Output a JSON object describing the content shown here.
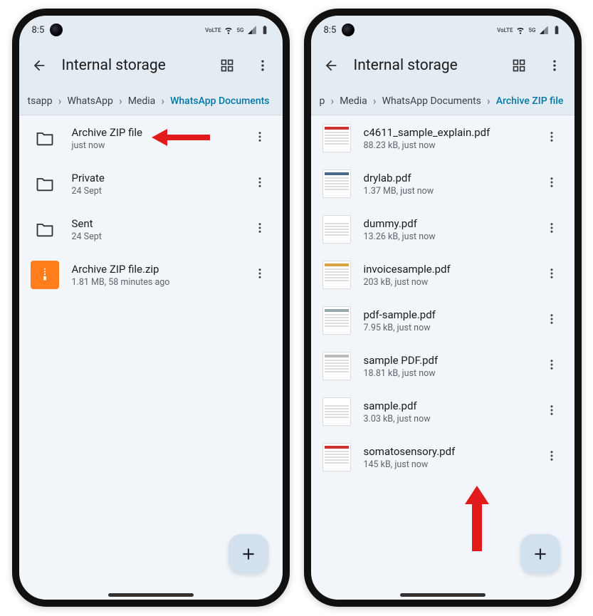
{
  "status": {
    "time": "8:5",
    "net1": "VoLTE",
    "net2": "5G"
  },
  "appbar": {
    "title": "Internal storage"
  },
  "phone1": {
    "breadcrumb": [
      {
        "label": "tsapp",
        "active": false,
        "truncated": true
      },
      {
        "label": "WhatsApp",
        "active": false
      },
      {
        "label": "Media",
        "active": false
      },
      {
        "label": "WhatsApp Documents",
        "active": true
      }
    ],
    "items": [
      {
        "kind": "folder",
        "title": "Archive ZIP file",
        "sub": "just now"
      },
      {
        "kind": "folder",
        "title": "Private",
        "sub": "24 Sept"
      },
      {
        "kind": "folder",
        "title": "Sent",
        "sub": "24 Sept"
      },
      {
        "kind": "zip",
        "title": "Archive ZIP file.zip",
        "sub": "1.81 MB, 58 minutes ago"
      }
    ]
  },
  "phone2": {
    "breadcrumb": [
      {
        "label": "p",
        "active": false,
        "truncated": true
      },
      {
        "label": "Media",
        "active": false
      },
      {
        "label": "WhatsApp Documents",
        "active": false
      },
      {
        "label": "Archive ZIP file",
        "active": true
      }
    ],
    "items": [
      {
        "kind": "pdf",
        "title": "c4611_sample_explain.pdf",
        "sub": "88.23 kB, just now",
        "accent": "#c33"
      },
      {
        "kind": "pdf",
        "title": "drylab.pdf",
        "sub": "1.37 MB, just now",
        "accent": "#4a6b8c"
      },
      {
        "kind": "pdf",
        "title": "dummy.pdf",
        "sub": "13.26 kB, just now",
        "accent": "#fff"
      },
      {
        "kind": "pdf",
        "title": "invoicesample.pdf",
        "sub": "203 kB, just now",
        "accent": "#d9a441"
      },
      {
        "kind": "pdf",
        "title": "pdf-sample.pdf",
        "sub": "7.95 kB, just now",
        "accent": "#9aa"
      },
      {
        "kind": "pdf",
        "title": "sample PDF.pdf",
        "sub": "18.81 kB, just now",
        "accent": "#bbb"
      },
      {
        "kind": "pdf",
        "title": "sample.pdf",
        "sub": "3.03 kB, just now",
        "accent": "#fff"
      },
      {
        "kind": "pdf",
        "title": "somatosensory.pdf",
        "sub": "145 kB, just now",
        "accent": "#c33"
      }
    ]
  }
}
